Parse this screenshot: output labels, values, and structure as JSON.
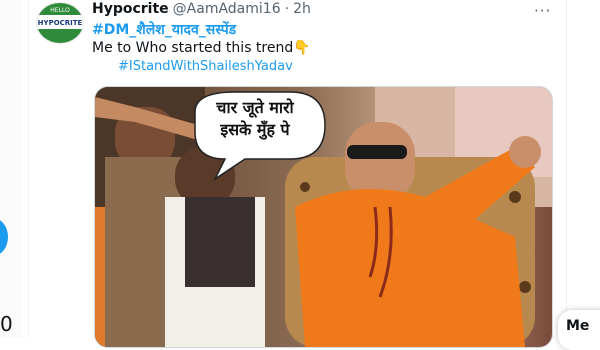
{
  "tweet": {
    "display_name": "Hypocrite",
    "handle": "@AamAdami16",
    "separator": "·",
    "timestamp": "2h",
    "hashtag_line": "#DM_शैलेश_यादव_सस्पेंड",
    "text_line": "Me to Who started this trend👇",
    "hashtag_line_2": "#IStandWithShaileshYadav",
    "more_icon": "···"
  },
  "avatar": {
    "text_top": "HELLO",
    "text_main": "HYPOCRITE",
    "colors": {
      "top": "#2e8b3a",
      "band": "#2e8b3a",
      "bg": "#ffffff"
    }
  },
  "media": {
    "speech_bubble_line1": "चार जूते मारो",
    "speech_bubble_line2": "इसके मुँह पे"
  },
  "left_panel": {
    "digit": "0"
  },
  "right_card": {
    "label": "Me"
  },
  "colors": {
    "link": "#1d9bf0",
    "muted": "#536471",
    "text": "#0f1419"
  }
}
